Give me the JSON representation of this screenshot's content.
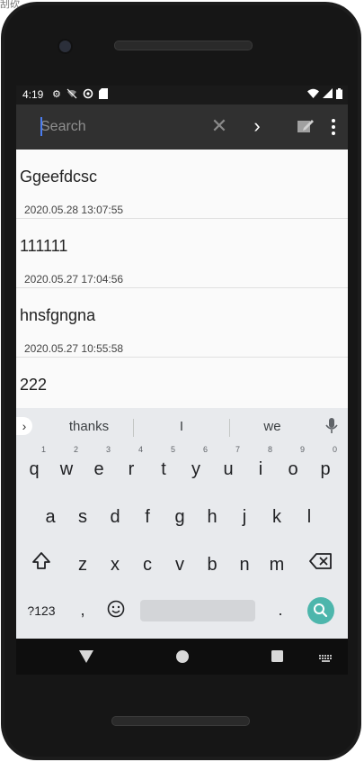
{
  "status_bar": {
    "time": "4:19",
    "left_icons": [
      "gear-icon",
      "wifi-off-icon",
      "sync-icon",
      "sd-card-icon"
    ],
    "right_icons": [
      "wifi-icon",
      "signal-icon",
      "battery-icon"
    ]
  },
  "toolbar": {
    "search_placeholder": "Search",
    "search_value": "",
    "clear_icon": "close-icon",
    "next_icon": "chevron-right-icon",
    "edit_icon": "compose-icon",
    "menu_icon": "more-vert-icon"
  },
  "notes": [
    {
      "title": "Ggeefdcsc",
      "date": "2020.05.28 13:07:55"
    },
    {
      "title": "111111",
      "date": "2020.05.27 17:04:56"
    },
    {
      "title": "hnsfgngna",
      "date": "2020.05.27 10:55:58"
    },
    {
      "title": "222",
      "date": ""
    }
  ],
  "keyboard": {
    "suggestions": [
      "thanks",
      "I",
      "we"
    ],
    "row1": [
      "q",
      "w",
      "e",
      "r",
      "t",
      "y",
      "u",
      "i",
      "o",
      "p"
    ],
    "row1_hints": [
      "1",
      "2",
      "3",
      "4",
      "5",
      "6",
      "7",
      "8",
      "9",
      "0"
    ],
    "row2": [
      "a",
      "s",
      "d",
      "f",
      "g",
      "h",
      "j",
      "k",
      "l"
    ],
    "row3": [
      "z",
      "x",
      "c",
      "v",
      "b",
      "n",
      "m"
    ],
    "symbols_label": "?123",
    "comma": ",",
    "period": ".",
    "accent_color": "#4db6ac"
  },
  "nav": {
    "back": "back-icon",
    "home": "home-icon",
    "recents": "recents-icon",
    "keyboard": "keyboard-icon"
  },
  "corner_label": "刮砍"
}
